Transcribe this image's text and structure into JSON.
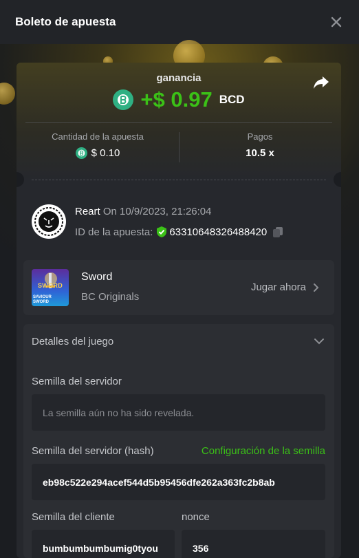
{
  "header": {
    "title": "Boleto de apuesta",
    "close_icon": "close-icon"
  },
  "win": {
    "label": "ganancia",
    "amount": "+$ 0.97",
    "currency": "BCD",
    "share_icon": "share-icon"
  },
  "stats": {
    "bet_label": "Cantidad de la apuesta",
    "bet_value": "$ 0.10",
    "payout_label": "Pagos",
    "payout_value": "10.5 x"
  },
  "user": {
    "name": "Reart",
    "date": "On 10/9/2023, 21:26:04",
    "bet_id_label": "ID de la apuesta:",
    "bet_id": "63310648326488420"
  },
  "game": {
    "thumb_text": "SWORD",
    "thumb_sub": "SAVIOUR SWORD",
    "name": "Sword",
    "provider": "BC Originals",
    "play_label": "Jugar ahora"
  },
  "details": {
    "heading": "Detalles del juego",
    "server_seed_label": "Semilla del servidor",
    "server_seed_placeholder": "La semilla aún no ha sido revelada.",
    "server_hash_label": "Semilla del servidor (hash)",
    "seed_config_link": "Configuración de la semilla",
    "server_hash_value": "eb98c522e294acef544d5b95456dfe262a363fc2b8ab",
    "client_seed_label": "Semilla del cliente",
    "client_seed_value": "bumbumbumbumig0tyou",
    "nonce_label": "nonce",
    "nonce_value": "356"
  },
  "colors": {
    "accent_green": "#3bc117",
    "coin_teal": "#2fb083",
    "background": "#1b1d21",
    "panel": "#26282d"
  }
}
